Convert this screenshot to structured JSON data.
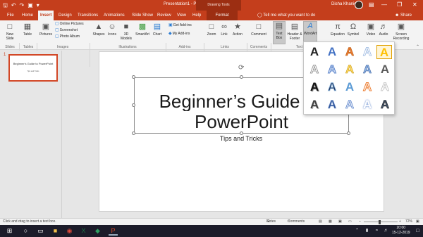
{
  "titlebar": {
    "doc_title": "Presentation1 - PowerPoint",
    "contextual": "Drawing Tools",
    "user_name": "Disha Khanie",
    "qat_icons": [
      "save-icon",
      "undo-icon",
      "redo-icon",
      "presenter-icon",
      "customize-icon"
    ],
    "window_controls": [
      "ribbon-options-icon",
      "minimize-icon",
      "restore-icon",
      "close-icon"
    ]
  },
  "tabs": [
    "File",
    "Home",
    "Insert",
    "Design",
    "Transitions",
    "Animations",
    "Slide Show",
    "Review",
    "View",
    "Help",
    "Format"
  ],
  "active_tab": "Insert",
  "tell_me": "Tell me what you want to do",
  "share_label": "Share",
  "ribbon": {
    "new_slide": "New Slide",
    "table": "Table",
    "pictures": "Pictures",
    "online_pictures": "Online Pictures",
    "screenshot": "Screenshot",
    "photo_album": "Photo Album",
    "shapes": "Shapes",
    "icons": "Icons",
    "models3d": "3D Models",
    "smartart": "SmartArt",
    "chart": "Chart",
    "get_addins": "Get Add-ins",
    "my_addins": "My Add-ins",
    "zoom": "Zoom",
    "link": "Link",
    "action": "Action",
    "comment": "Comment",
    "text_box": "Text Box",
    "header_footer": "Header & Footer",
    "wordart": "WordArt",
    "equation": "Equation",
    "symbol": "Symbol",
    "video": "Video",
    "audio": "Audio",
    "screen_recording": "Screen Recording",
    "groups": {
      "slides": "Slides",
      "tables": "Tables",
      "images": "Images",
      "illustrations": "Illustrations",
      "addins": "Add-ins",
      "links": "Links",
      "comments": "Comments",
      "text": "Text"
    }
  },
  "thumbnail": {
    "number": "1",
    "title": "Beginner's Guide to PowerPoint",
    "subtitle": "Tips and Tricks"
  },
  "slide": {
    "title_line1": "Beginner’s Guide to",
    "title_line2": "PowerPoint",
    "subtitle": "Tips and Tricks"
  },
  "wordart_glyph": "A",
  "colors": {
    "accent": "#c43e1c",
    "accent_dark": "#9c2e12",
    "ribbon_bg": "#f3f3f3",
    "taskbar": "#1c1c2a"
  },
  "status": {
    "hint": "Click and drag to insert a text box.",
    "notes": "Notes",
    "comments": "Comments",
    "zoom": "72%"
  },
  "taskbar": {
    "time": "20:00",
    "date": "15-12-2019"
  }
}
